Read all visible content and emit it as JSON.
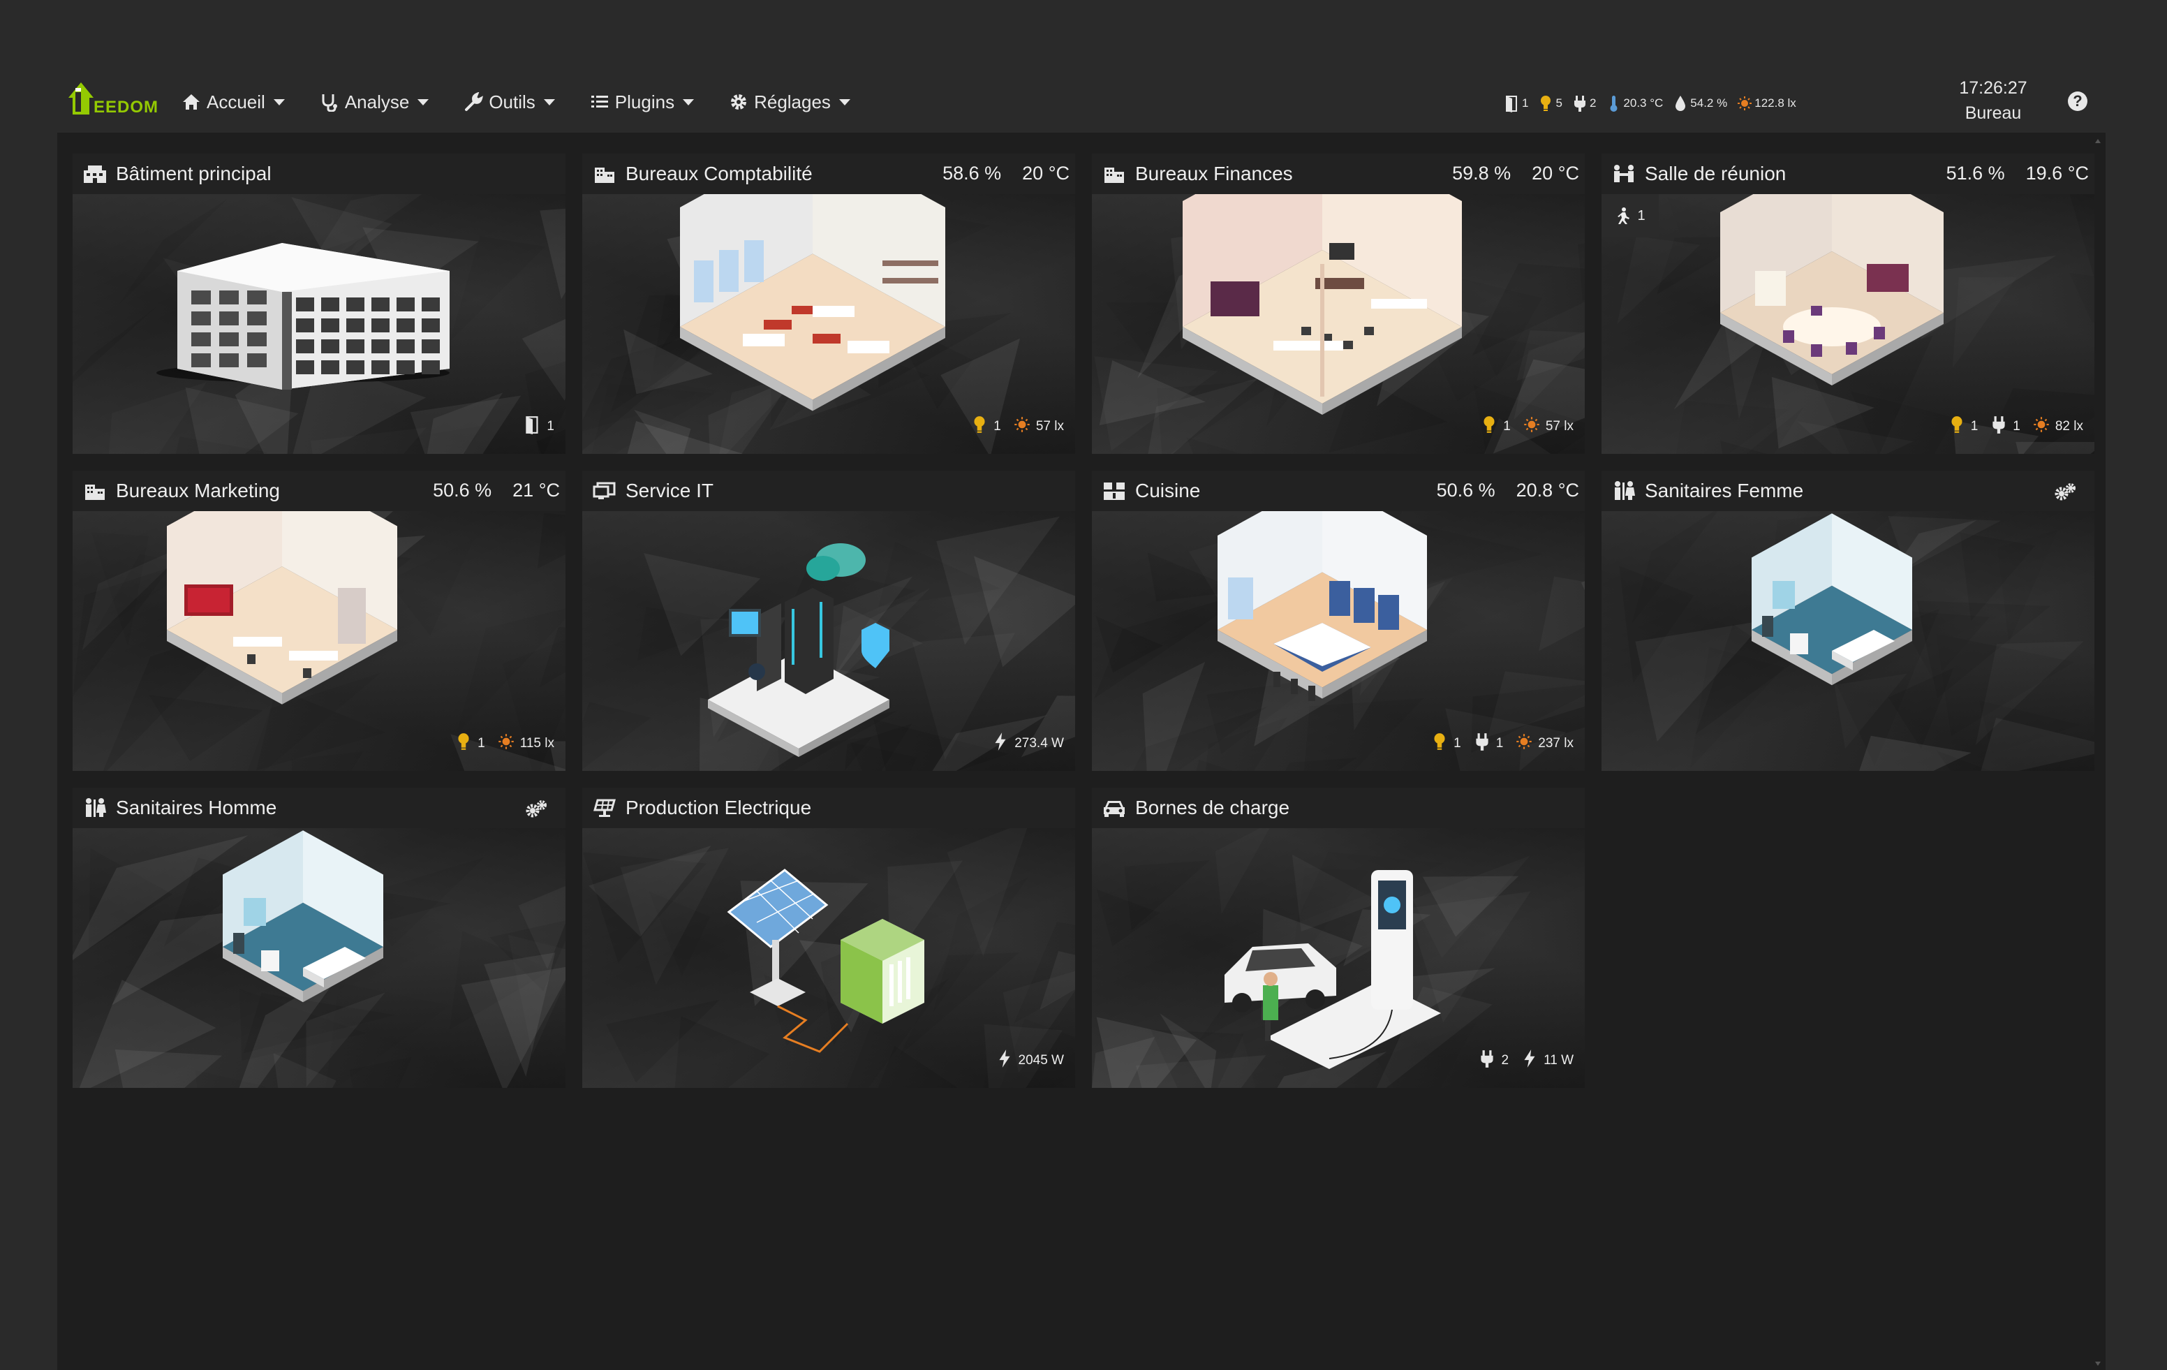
{
  "brand": {
    "logo_text": "EEDOM"
  },
  "nav": {
    "items": [
      {
        "label": "Accueil",
        "icon": "home-icon"
      },
      {
        "label": "Analyse",
        "icon": "stethoscope-icon"
      },
      {
        "label": "Outils",
        "icon": "wrench-icon"
      },
      {
        "label": "Plugins",
        "icon": "list-icon"
      },
      {
        "label": "Réglages",
        "icon": "gear-icon"
      }
    ]
  },
  "summary": {
    "door": "1",
    "light": "5",
    "plug": "2",
    "temperature": "20.3 °C",
    "humidity": "54.2 %",
    "luminosity": "122.8 lx"
  },
  "clock": {
    "time": "17:26:27",
    "location": "Bureau"
  },
  "help": {
    "label": "?"
  },
  "rooms": [
    {
      "title": "Bâtiment principal",
      "icon": "building-icon",
      "humidity": "",
      "temperature": "",
      "scene": "building",
      "footer": [
        {
          "icon": "door-icon",
          "value": "1"
        }
      ]
    },
    {
      "title": "Bureaux Comptabilité",
      "icon": "office-icon",
      "humidity": "58.6 %",
      "temperature": "20 °C",
      "scene": "office",
      "footer": [
        {
          "icon": "bulb-icon",
          "value": "1"
        },
        {
          "icon": "sun-icon",
          "value": "57 lx"
        }
      ]
    },
    {
      "title": "Bureaux Finances",
      "icon": "office-icon",
      "humidity": "59.8 %",
      "temperature": "20 °C",
      "scene": "finance",
      "footer": [
        {
          "icon": "bulb-icon",
          "value": "1"
        },
        {
          "icon": "sun-icon",
          "value": "57 lx"
        }
      ]
    },
    {
      "title": "Salle de réunion",
      "icon": "meeting-icon",
      "humidity": "51.6 %",
      "temperature": "19.6 °C",
      "scene": "meeting",
      "badge": "1",
      "footer": [
        {
          "icon": "bulb-icon",
          "value": "1"
        },
        {
          "icon": "plug-icon",
          "value": "1"
        },
        {
          "icon": "sun-icon",
          "value": "82 lx"
        }
      ]
    },
    {
      "title": "Bureaux Marketing",
      "icon": "office-icon",
      "humidity": "50.6 %",
      "temperature": "21 °C",
      "scene": "marketing",
      "footer": [
        {
          "icon": "bulb-icon",
          "value": "1"
        },
        {
          "icon": "sun-icon",
          "value": "115 lx"
        }
      ]
    },
    {
      "title": "Service IT",
      "icon": "monitor-icon",
      "humidity": "",
      "temperature": "",
      "scene": "it",
      "footer": [
        {
          "icon": "bolt-icon",
          "value": "273.4 W"
        }
      ]
    },
    {
      "title": "Cuisine",
      "icon": "kitchen-icon",
      "humidity": "50.6 %",
      "temperature": "20.8 °C",
      "scene": "kitchen",
      "footer": [
        {
          "icon": "bulb-icon",
          "value": "1"
        },
        {
          "icon": "plug-icon",
          "value": "1"
        },
        {
          "icon": "sun-icon",
          "value": "237 lx"
        }
      ]
    },
    {
      "title": "Sanitaires Femme",
      "icon": "restroom-icon",
      "humidity": "",
      "temperature": "",
      "scene": "bath",
      "gear": true,
      "footer": []
    },
    {
      "title": "Sanitaires Homme",
      "icon": "restroom-icon",
      "humidity": "",
      "temperature": "",
      "scene": "bath",
      "gear": true,
      "footer": []
    },
    {
      "title": "Production Electrique",
      "icon": "solar-icon",
      "humidity": "",
      "temperature": "",
      "scene": "solar",
      "footer": [
        {
          "icon": "bolt-icon",
          "value": "2045 W"
        }
      ]
    },
    {
      "title": "Bornes de charge",
      "icon": "car-icon",
      "humidity": "",
      "temperature": "",
      "scene": "charger",
      "footer": [
        {
          "icon": "plug-icon",
          "value": "2"
        },
        {
          "icon": "bolt-icon",
          "value": "11 W"
        }
      ]
    }
  ],
  "colors": {
    "accent": "#94ca02",
    "bulb": "#e8b012",
    "sun": "#e67e22",
    "temp": "#5b9bd5",
    "background": "#1e1e1e",
    "header": "#2a2a2a"
  }
}
